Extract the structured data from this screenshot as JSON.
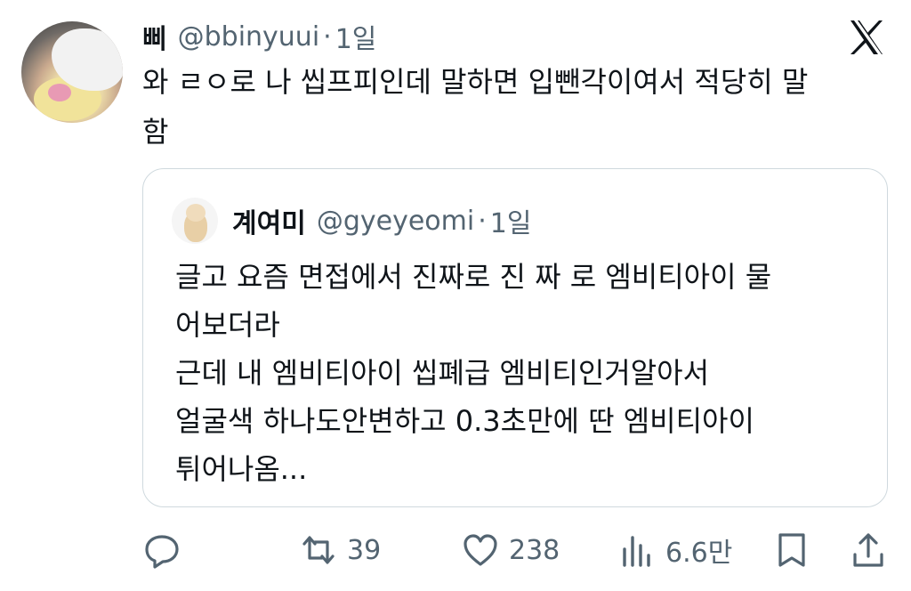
{
  "tweet": {
    "author_name": "삐",
    "handle": "@bbinyuui",
    "separator": "·",
    "time": "1일",
    "text": "와 ㄹㅇ로 나 씹프피인데 말하면 입뺀각이여서 적당히 말\n함"
  },
  "quoted": {
    "author_name": "계여미",
    "handle": "@gyeyeomi",
    "separator": "·",
    "time": "1일",
    "text": "글고 요즘 면접에서 진짜로 진 짜 로 엠비티아이 물\n어보더라\n근데 내 엠비티아이 씹폐급 엠비티인거알아서\n얼굴색 하나도안변하고 0.3초만에 딴 엠비티아이\n튀어나옴..."
  },
  "actions": {
    "reply": {
      "icon": "reply-icon",
      "count": ""
    },
    "retweet": {
      "icon": "retweet-icon",
      "count": "39"
    },
    "like": {
      "icon": "heart-icon",
      "count": "238"
    },
    "views": {
      "icon": "views-icon",
      "count": "6.6만"
    },
    "bookmark": {
      "icon": "bookmark-icon"
    },
    "share": {
      "icon": "share-icon"
    }
  },
  "brand": {
    "icon": "x-logo-icon"
  },
  "colors": {
    "text": "#0f1419",
    "secondary": "#536471",
    "border": "#cfd9de"
  }
}
